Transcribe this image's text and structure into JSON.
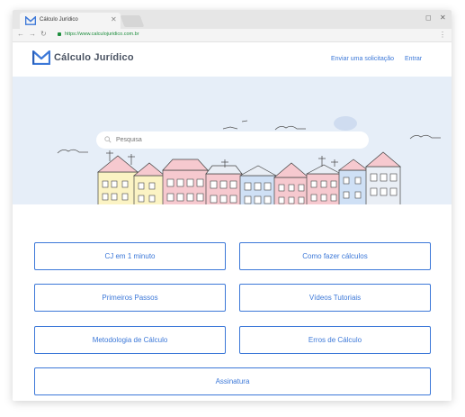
{
  "browser": {
    "tab_title": "Cálculo Jurídico",
    "url": "https://www.calculojuridico.com.br"
  },
  "header": {
    "logo_text": "Cálculo Jurídico",
    "nav": [
      "Enviar uma solicitação",
      "Entrar"
    ]
  },
  "hero": {
    "search_placeholder": "Pesquisa"
  },
  "buttons": [
    "CJ em 1 minuto",
    "Como fazer cálculos",
    "Primeiros Passos",
    "Vídeos Tutoriais",
    "Metodologia de Cálculo",
    "Erros de Cálculo",
    "Assinatura"
  ],
  "colors": {
    "accent": "#3c78d8",
    "hero_bg": "#e6eef8",
    "logo_text": "#4a5362"
  }
}
